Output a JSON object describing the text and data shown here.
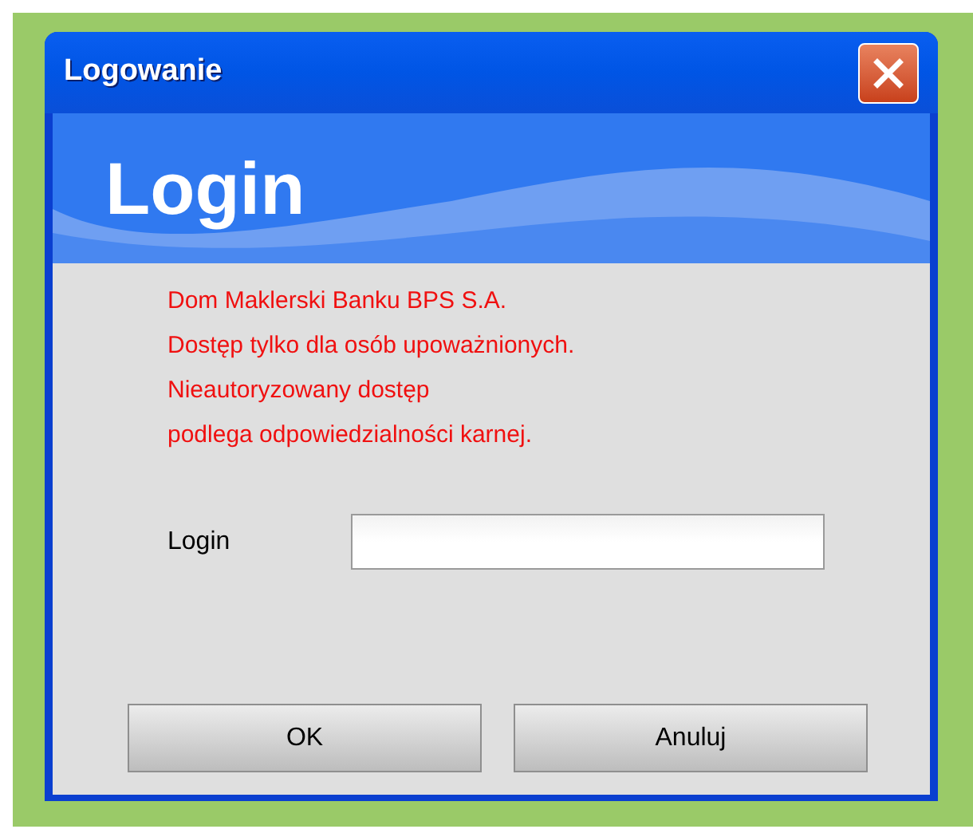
{
  "window": {
    "title": "Logowanie"
  },
  "banner": {
    "title": "Login"
  },
  "warning_lines": [
    "Dom Maklerski Banku BPS S.A.",
    "Dostęp tylko dla osób upoważnionych.",
    "Nieautoryzowany dostęp",
    "podlega odpowiedzialności karnej."
  ],
  "login_field": {
    "label": "Login"
  },
  "buttons": [
    "OK",
    "Anuluj"
  ]
}
